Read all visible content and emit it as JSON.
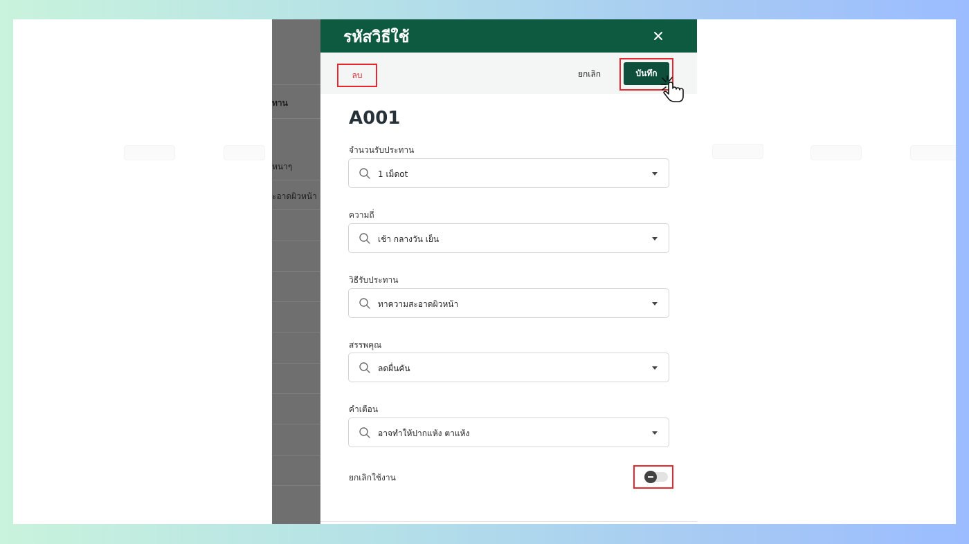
{
  "background_list": {
    "header": "ทาน",
    "rows": [
      "หนาๆ",
      "ะอาดผิวหน้า"
    ]
  },
  "modal": {
    "title": "รหัสวิธีใช้",
    "close_icon": "close-icon",
    "actions": {
      "delete_label": "ลบ",
      "cancel_label": "ยกเลิก",
      "save_label": "บันทึก"
    },
    "code": "A001",
    "fields": [
      {
        "label": "จำนวนรับประทาน",
        "value": "1 เม็ดot"
      },
      {
        "label": "ความถี่",
        "value": "เช้า กลางวัน เย็น"
      },
      {
        "label": "วิธีรับประทาน",
        "value": "ทาความสะอาดผิวหน้า"
      },
      {
        "label": "สรรพคุณ",
        "value": "ลดผื่นคัน"
      },
      {
        "label": "คำเตือน",
        "value": "อาจทำให้ปากแห้ง ตาแห้ง"
      }
    ],
    "toggle": {
      "label": "ยกเลิกใช้งาน",
      "enabled": false
    }
  },
  "colors": {
    "header_green": "#0e5a40",
    "save_green": "#0e4f3b",
    "highlight_red": "#e8262d"
  }
}
